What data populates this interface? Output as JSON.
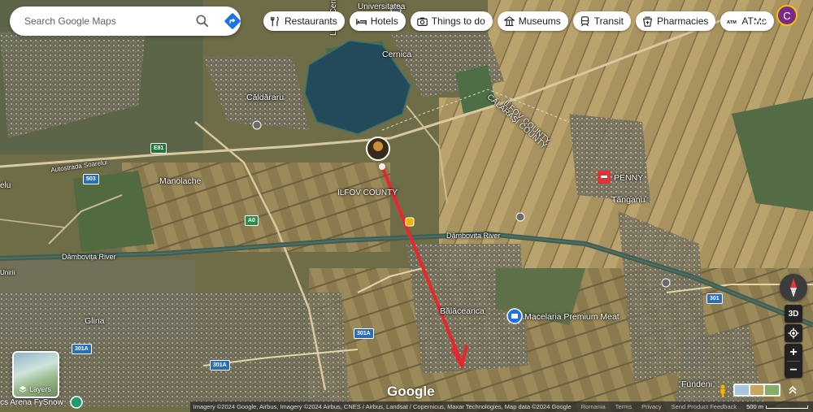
{
  "search": {
    "placeholder": "Search Google Maps"
  },
  "chips": [
    {
      "label": "Restaurants",
      "icon": "fork-knife-icon"
    },
    {
      "label": "Hotels",
      "icon": "bed-icon"
    },
    {
      "label": "Things to do",
      "icon": "camera-icon"
    },
    {
      "label": "Museums",
      "icon": "museum-icon"
    },
    {
      "label": "Transit",
      "icon": "train-icon"
    },
    {
      "label": "Pharmacies",
      "icon": "pharmacy-icon"
    },
    {
      "label": "ATMs",
      "icon": "atm-icon"
    }
  ],
  "account": {
    "initial": "C",
    "color": "#7a2a8a"
  },
  "map": {
    "places": [
      {
        "name": "Universitatea"
      },
      {
        "name": "Lacul Cernica"
      },
      {
        "name": "Cernica"
      },
      {
        "name": "Căldăraru"
      },
      {
        "name": "ILFOV COUNTY"
      },
      {
        "name": "CĂLĂRAȘI COUNTY"
      },
      {
        "name": "PENNY"
      },
      {
        "name": "Tânganu"
      },
      {
        "name": "Manolache"
      },
      {
        "name": "ILFOV COUNTY"
      },
      {
        "name": "Dâmbovița River"
      },
      {
        "name": "Dâmbovița River"
      },
      {
        "name": "Bălăceanca"
      },
      {
        "name": "Macelaria Premium Meat"
      },
      {
        "name": "Glina"
      },
      {
        "name": "Fundeni"
      },
      {
        "name": "Autostrada Soarelui"
      },
      {
        "name": "elu"
      },
      {
        "name": "Unirii"
      }
    ],
    "road_labels": [
      "E81",
      "503",
      "A0",
      "301A",
      "301A",
      "301A",
      "301"
    ]
  },
  "controls": {
    "tilt_label": "3D",
    "zoom_in": "+",
    "zoom_out": "−"
  },
  "layers": {
    "label": "Layers"
  },
  "bottom_left_text": "cs Arena FySnow",
  "logo": "Google",
  "attribution": {
    "imagery": "Imagery ©2024 Google, Airbus, Imagery ©2024 Airbus, CNES / Airbus, Landsat / Copernicus, Maxar Technologies, Map data ©2024 Google",
    "country": "Romania",
    "terms": "Terms",
    "privacy": "Privacy",
    "feedback": "Send Product Feedback",
    "scale": "500 m"
  },
  "colors": {
    "route_arrow": "#e8262c",
    "accent": "#1a73e8"
  }
}
